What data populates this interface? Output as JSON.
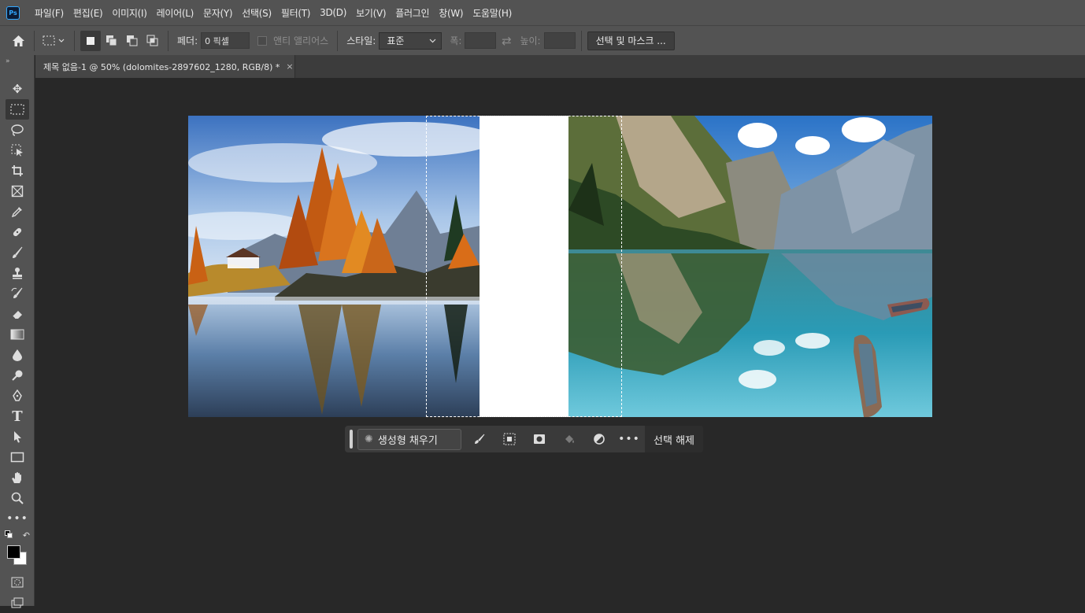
{
  "app": {
    "logo_text": "Ps"
  },
  "menu": [
    "파일(F)",
    "편집(E)",
    "이미지(I)",
    "레이어(L)",
    "문자(Y)",
    "선택(S)",
    "필터(T)",
    "3D(D)",
    "보기(V)",
    "플러그인",
    "창(W)",
    "도움말(H)"
  ],
  "options": {
    "feather_label": "페더:",
    "feather_value": "0 픽셀",
    "antialias_label": "앤티 앨리어스",
    "style_label": "스타일:",
    "style_value": "표준",
    "width_label": "폭:",
    "height_label": "높이:",
    "select_mask_label": "선택 및 마스크 ..."
  },
  "document": {
    "tab_title": "제목 없음-1 @ 50% (dolomites-2897602_1280, RGB/8) *",
    "close_glyph": "×"
  },
  "context_bar": {
    "generative_fill_label": "생성형 채우기",
    "deselect_label": "선택 해제"
  },
  "colors": {
    "foreground": "#000000",
    "background": "#ffffff",
    "accent": "#31a8ff"
  }
}
